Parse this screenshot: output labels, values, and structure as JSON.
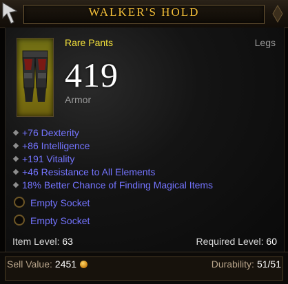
{
  "item": {
    "name": "WALKER'S HOLD",
    "type": "Rare Pants",
    "slot": "Legs",
    "armor_value": "419",
    "armor_label": "Armor",
    "icon": "pants-item-icon"
  },
  "affixes": [
    "+76 Dexterity",
    "+86 Intelligence",
    "+191 Vitality",
    "+46 Resistance to All Elements",
    "18% Better Chance of Finding Magical Items"
  ],
  "sockets": [
    "Empty Socket",
    "Empty Socket"
  ],
  "levels": {
    "item_level_label": "Item Level:",
    "item_level_value": "63",
    "required_level_label": "Required Level:",
    "required_level_value": "60"
  },
  "footer": {
    "sell_value_label": "Sell Value:",
    "sell_value_amount": "2451",
    "durability_label": "Durability:",
    "durability_value": "51/51"
  },
  "colors": {
    "title": "#f8c23a",
    "rare_name": "#f6e33b",
    "affix": "#7474ff",
    "label_gray": "#9a9a9a"
  }
}
